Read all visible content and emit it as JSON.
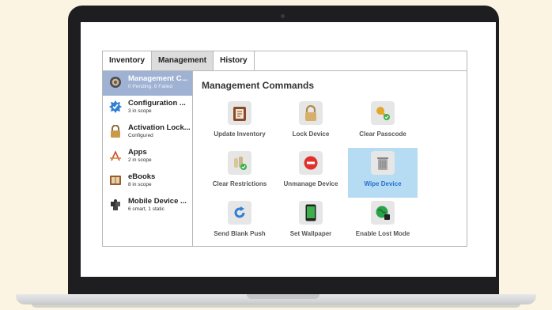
{
  "tabs": [
    {
      "label": "Inventory"
    },
    {
      "label": "Management"
    },
    {
      "label": "History"
    }
  ],
  "sidebar": {
    "items": [
      {
        "title": "Management C...",
        "subtitle": "0 Pending, 6 Failed",
        "icon": "management-commands-icon"
      },
      {
        "title": "Configuration ...",
        "subtitle": "3 in scope",
        "icon": "configuration-badge-icon"
      },
      {
        "title": "Activation Lock...",
        "subtitle": "Configured",
        "icon": "padlock-icon"
      },
      {
        "title": "Apps",
        "subtitle": "2 in scope",
        "icon": "app-store-icon"
      },
      {
        "title": "eBooks",
        "subtitle": "8 in scope",
        "icon": "book-icon"
      },
      {
        "title": "Mobile Device ...",
        "subtitle": "6 smart, 1 static",
        "icon": "puzzle-piece-icon"
      }
    ]
  },
  "main": {
    "title": "Management Commands",
    "commands": [
      {
        "label": "Update Inventory",
        "icon": "clipboard-icon"
      },
      {
        "label": "Lock Device",
        "icon": "lock-icon"
      },
      {
        "label": "Clear Passcode",
        "icon": "key-icon"
      },
      {
        "label": "Clear Restrictions",
        "icon": "clear-restrictions-icon"
      },
      {
        "label": "Unmanage Device",
        "icon": "no-entry-icon"
      },
      {
        "label": "Wipe Device",
        "icon": "trash-icon"
      },
      {
        "label": "Send Blank Push",
        "icon": "refresh-icon"
      },
      {
        "label": "Set Wallpaper",
        "icon": "phone-wallpaper-icon"
      },
      {
        "label": "Enable Lost Mode",
        "icon": "globe-icon"
      }
    ]
  },
  "colors": {
    "background": "#fbf4e2",
    "sidebar_selected": "#9fb2d3",
    "command_selected": "#b5dcf3",
    "selected_label": "#2a6fcf"
  }
}
